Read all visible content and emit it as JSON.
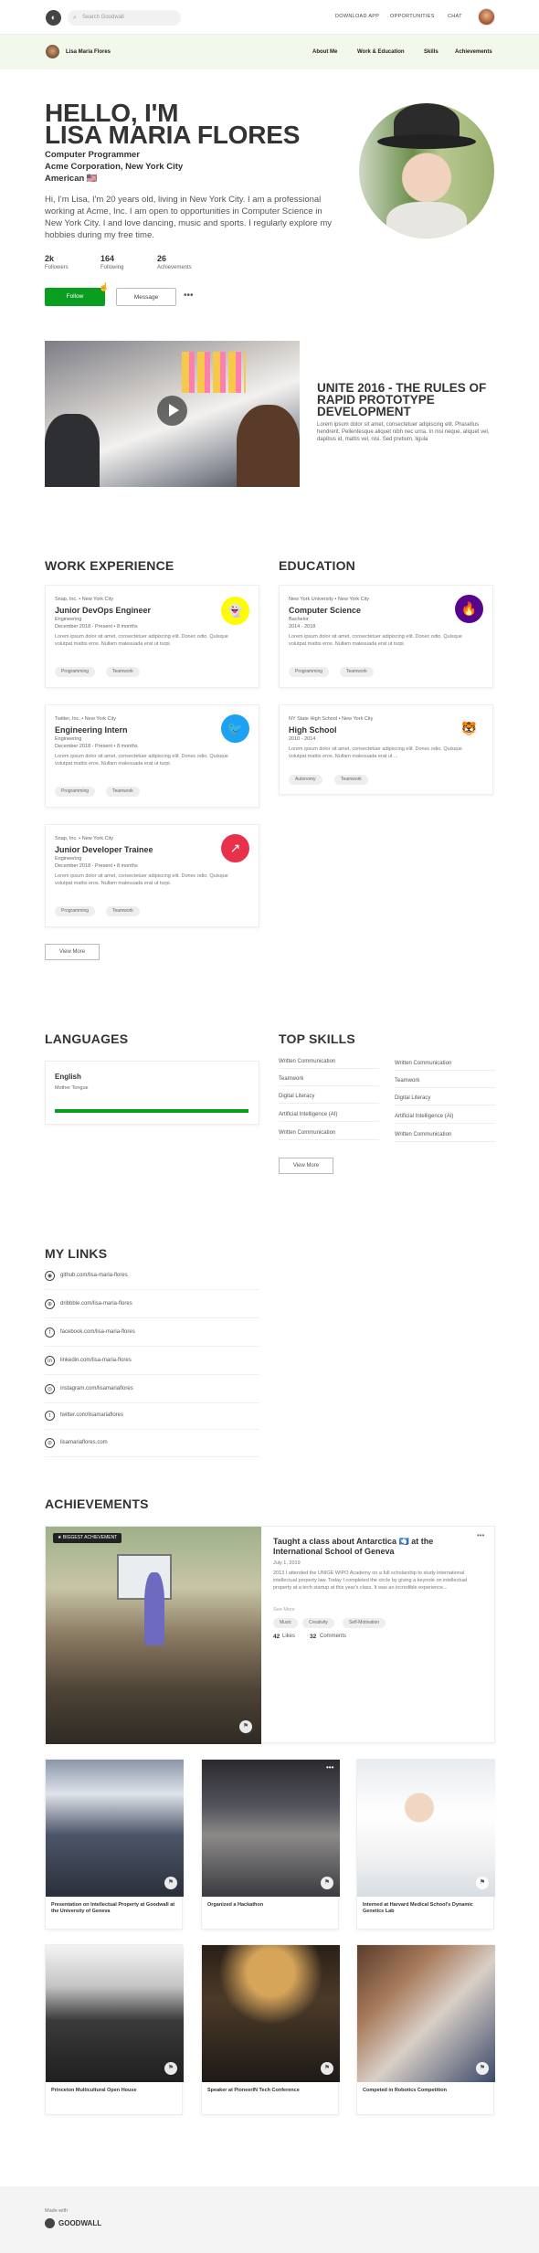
{
  "topbar": {
    "search_placeholder": "Search Goodwall",
    "links": [
      "DOWNLOAD APP",
      "OPPORTUNITIES",
      "CHAT"
    ]
  },
  "subbar": {
    "name": "Lisa Maria Flores",
    "links": [
      "About Me",
      "Work & Education",
      "Skills",
      "Achievements"
    ]
  },
  "hero": {
    "line1": "HELLO, I'M",
    "line2": "LISA MARIA FLORES",
    "role": "Computer Programmer",
    "company": "Acme Corporation, New York City",
    "nationality": "American 🇺🇸",
    "bio": "Hi, I'm Lisa, I'm 20 years old, living in New York City. I am a professional working at Acme, Inc. I am open to opportunities in Computer Science in New York City. I and love dancing, music and sports. I regularly explore my hobbies during my free time.",
    "stats": [
      {
        "value": "2k",
        "label": "Followers"
      },
      {
        "value": "164",
        "label": "Following"
      },
      {
        "value": "26",
        "label": "Achievements"
      }
    ],
    "follow_label": "Follow",
    "message_label": "Message",
    "more_label": "•••"
  },
  "video": {
    "title": "UNITE 2016 - THE RULES OF RAPID PROTOTYPE DEVELOPMENT",
    "desc": "Lorem ipsum dolor sit amet, consectetuer adipiscing elit. Phasellus hendrerit. Pellentesque aliquet nibh nec urna. In nisi neque, aliquet vel, dapibus id, mattis vel, nisi. Sed pretium, ligula"
  },
  "work": {
    "heading": "WORK EXPERIENCE",
    "items": [
      {
        "org": "Snap, Inc. • New York City",
        "title": "Junior DevOps Engineer",
        "dept": "Engineering",
        "dates": "December 2018 - Present • 8 months",
        "text": "Lorem ipsum dolor sit amet, consectetuer adipiscing elit. Donec odio. Quisque volutpat mattis eros. Nullam malesuada erat ut turpi.",
        "tags": [
          "Programming",
          "Teamwork"
        ]
      },
      {
        "org": "Twitter, Inc. • New York City",
        "title": "Engineering Intern",
        "dept": "Engineering",
        "dates": "December 2018 - Present • 8 months",
        "text": "Lorem ipsum dolor sit amet, consectetuer adipiscing elit. Donec odio. Quisque volutpat mattis eros. Nullam malesuada erat ut turpi.",
        "tags": [
          "Programming",
          "Teamwork"
        ]
      },
      {
        "org": "Snap, Inc. • New York City",
        "title": "Junior Developer Trainee",
        "dept": "Engineering",
        "dates": "December 2018 - Present • 8 months",
        "text": "Lorem ipsum dolor sit amet, consectetuer adipiscing elit. Donec odio. Quisque volutpat mattis eros. Nullam malesuada erat ut turpi.",
        "tags": [
          "Programming",
          "Teamwork"
        ]
      }
    ],
    "view_more": "View More"
  },
  "education": {
    "heading": "EDUCATION",
    "items": [
      {
        "org": "New York University • New York City",
        "title": "Computer Science",
        "dept": "Bachelor",
        "dates": "2014 - 2018",
        "text": "Lorem ipsum dolor sit amet, consectetuer adipiscing elit. Donec odio. Quisque volutpat mattis eros. Nullam malesuada erat ut turpi.",
        "tags": [
          "Programming",
          "Teamwork"
        ]
      },
      {
        "org": "NY State High School • New York City",
        "title": "High School",
        "dept": "",
        "dates": "2010 - 2014",
        "text": "Lorem ipsum dolor sit amet, consectetuer adipiscing elit. Donec odio. Quisque volutpat mattis eros. Nullam malesuada erat ut ...",
        "tags": [
          "Autonomy",
          "Teamwork"
        ]
      }
    ]
  },
  "languages": {
    "heading": "LANGUAGES",
    "name": "English",
    "level": "Mother Tongue",
    "proficiency": 1.0
  },
  "skills": {
    "heading": "TOP SKILLS",
    "left": [
      "Written Communication",
      "Teamwork",
      "Digital Literacy",
      "Artificial Intelligence (AI)",
      "Written Communication"
    ],
    "right": [
      "Written Communication",
      "Teamwork",
      "Digital Literacy",
      "Artificial Intelligence (AI)",
      "Written Communication"
    ],
    "view_more": "View More"
  },
  "links": {
    "heading": "MY LINKS",
    "items": [
      {
        "icon": "github-icon",
        "glyph": "◉",
        "text": "github.com/lisa-maria-flores"
      },
      {
        "icon": "dribbble-icon",
        "glyph": "⊕",
        "text": "dribbble.com/lisa-maria-flores"
      },
      {
        "icon": "facebook-icon",
        "glyph": "f",
        "text": "facebook.com/lisa-maria-flores"
      },
      {
        "icon": "linkedin-icon",
        "glyph": "in",
        "text": "linkedin.com/lisa-maria-flores"
      },
      {
        "icon": "instagram-icon",
        "glyph": "◎",
        "text": "instagram.com/lisamariaflores"
      },
      {
        "icon": "twitter-icon",
        "glyph": "t",
        "text": "twitter.com/lisamariaflores"
      },
      {
        "icon": "website-icon",
        "glyph": "⊘",
        "text": "lisamariaflores.com"
      }
    ]
  },
  "achievements": {
    "heading": "ACHIEVEMENTS",
    "featured": {
      "badge": "BIGGEST ACHIEVEMENT",
      "title": "Taught a class about Antarctica 🇦🇶 at the International School of Geneva",
      "date": "July 1, 2019",
      "text": "2013 I attended the UNIGE WIPO Academy on a full scholarship to study international intellectual property law. Today I completed the circle by giving a keynote on intellectual property at a tech startup at this year's class. It was an incredible experience...",
      "see_more": "See More",
      "tags": [
        "Music",
        "Creativity",
        "Self-Motivation"
      ],
      "likes": "42",
      "likes_label": "Likes",
      "comments": "32",
      "comments_label": "Comments",
      "more": "•••"
    },
    "items": [
      "Presentation on Intellectual Property at Goodwall at the University of Geneva",
      "Organized a Hackathon",
      "Interned at Harvard Medical School's Dynamic Genetics Lab",
      "Princeton Multicultural Open House",
      "Speaker at PioneerIN Tech Conference",
      "Competed in Robotics Competition"
    ]
  },
  "footer": {
    "made_with": "Made with",
    "brand": "GOODWALL"
  },
  "colors": {
    "accent": "#0a9e20",
    "subbar": "#f3f8ec"
  }
}
